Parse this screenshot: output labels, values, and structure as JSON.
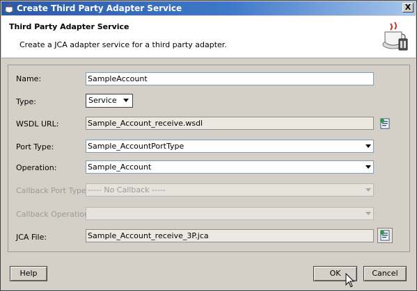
{
  "window": {
    "title": "Create Third Party Adapter Service",
    "close_label": "X"
  },
  "header": {
    "title": "Third Party Adapter Service",
    "description": "Create a JCA adapter service for a third party adapter.",
    "icon": "coffee-cup-adapter-icon"
  },
  "form": {
    "name": {
      "label": "Name:",
      "value": "SampleAccount"
    },
    "type": {
      "label": "Type:",
      "value": "Service"
    },
    "wsdl_url": {
      "label": "WSDL URL:",
      "value": "Sample_Account_receive.wsdl"
    },
    "port_type": {
      "label": "Port Type:",
      "value": "Sample_AccountPortType"
    },
    "operation": {
      "label": "Operation:",
      "value": "Sample_Account"
    },
    "callback_port_type": {
      "label": "Callback Port Type:",
      "value": "----- No Callback -----"
    },
    "callback_operation": {
      "label": "Callback Operation:",
      "value": ""
    },
    "jca_file": {
      "label": "JCA File:",
      "value": "Sample_Account_receive_3P.jca"
    }
  },
  "buttons": {
    "help": "Help",
    "ok": "OK",
    "cancel": "Cancel"
  },
  "colors": {
    "title_bar": "#2b5aa6",
    "dialog_bg": "#d4d0c8",
    "field_border": "#7f9db9"
  }
}
